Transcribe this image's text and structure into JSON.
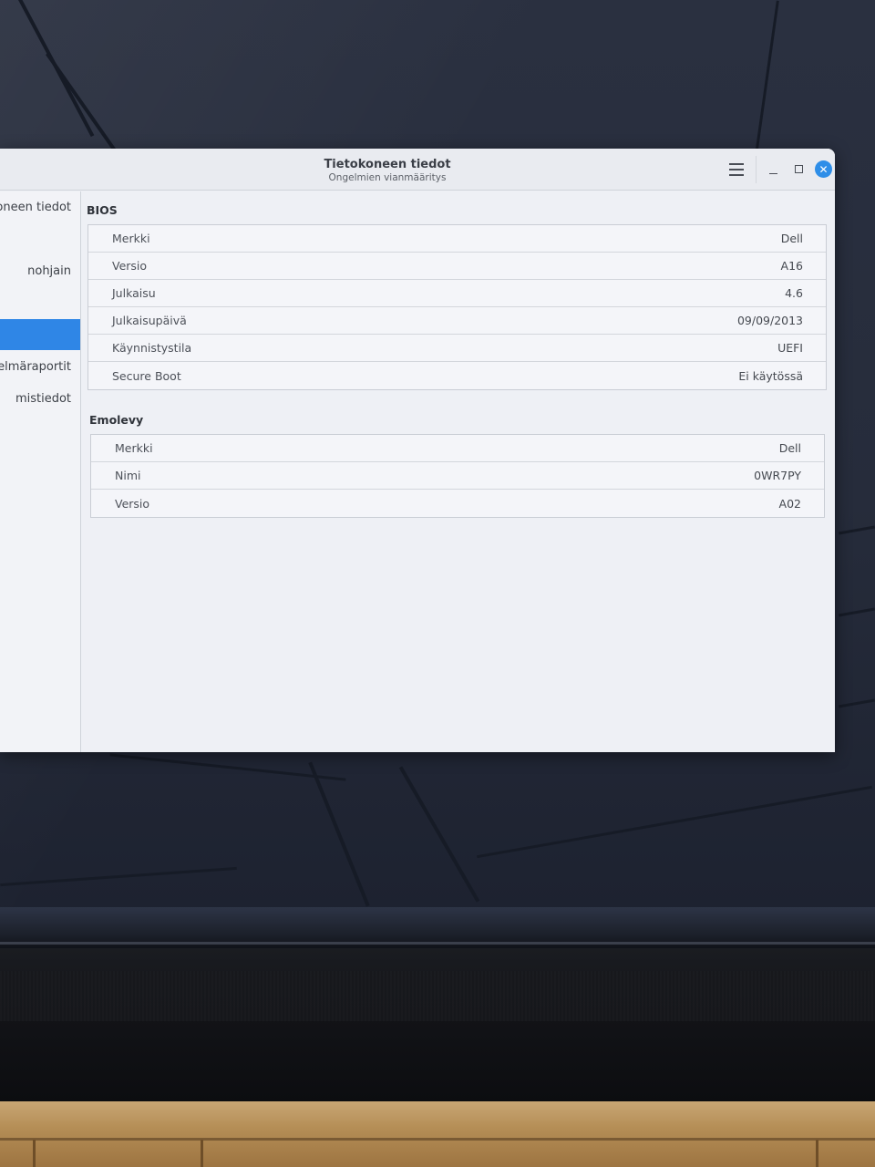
{
  "window": {
    "title": "Tietokoneen tiedot",
    "subtitle": "Ongelmien vianmääritys",
    "close_glyph": "✕"
  },
  "sidebar": {
    "items": [
      {
        "label": "oneen tiedot",
        "active": false
      },
      {
        "label": "nohjain",
        "active": false
      },
      {
        "label": "",
        "active": true
      },
      {
        "label": "celmäraportit",
        "active": false
      },
      {
        "label": "mistiedot",
        "active": false
      }
    ]
  },
  "bios": {
    "title": "BIOS",
    "rows": [
      {
        "key": "Merkki",
        "value": "Dell"
      },
      {
        "key": "Versio",
        "value": "A16"
      },
      {
        "key": "Julkaisu",
        "value": "4.6"
      },
      {
        "key": "Julkaisupäivä",
        "value": "09/09/2013"
      },
      {
        "key": "Käynnistystila",
        "value": "UEFI"
      },
      {
        "key": "Secure Boot",
        "value": "Ei käytössä"
      }
    ]
  },
  "motherboard": {
    "title": "Emolevy",
    "rows": [
      {
        "key": "Merkki",
        "value": "Dell"
      },
      {
        "key": "Nimi",
        "value": "0WR7PY"
      },
      {
        "key": "Versio",
        "value": "A02"
      }
    ]
  },
  "colors": {
    "accent": "#2f86e6",
    "close_button": "#2e8ee8",
    "window_bg": "#eef0f5"
  },
  "icons": {
    "menu": "hamburger-menu-icon",
    "minimize": "minimize-icon",
    "maximize": "maximize-icon",
    "close": "close-icon"
  }
}
